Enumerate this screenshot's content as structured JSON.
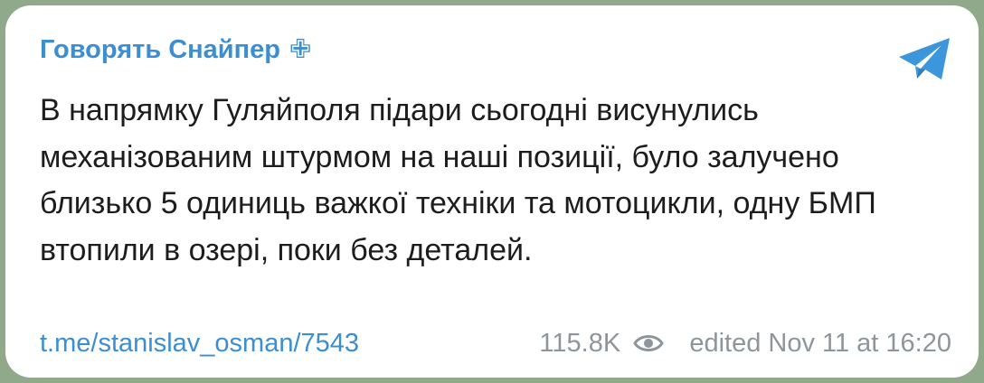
{
  "channel": {
    "name": "Говорять Снайпер",
    "badge": "✙",
    "icon": "telegram-icon",
    "color": "#3c8ed3"
  },
  "message": {
    "text": "В напрямку Гуляйполя підари сьогодні висунулись механізованим штурмом на наші позиції, було залучено близько 5 одиниць важкої техніки та мотоцикли, одну БМП втопили в озері, поки без деталей."
  },
  "footer": {
    "link": "t.me/stanislav_osman/7543",
    "views": "115.8K",
    "views_icon": "eye-icon",
    "timestamp": "edited Nov 11 at 16:20"
  }
}
